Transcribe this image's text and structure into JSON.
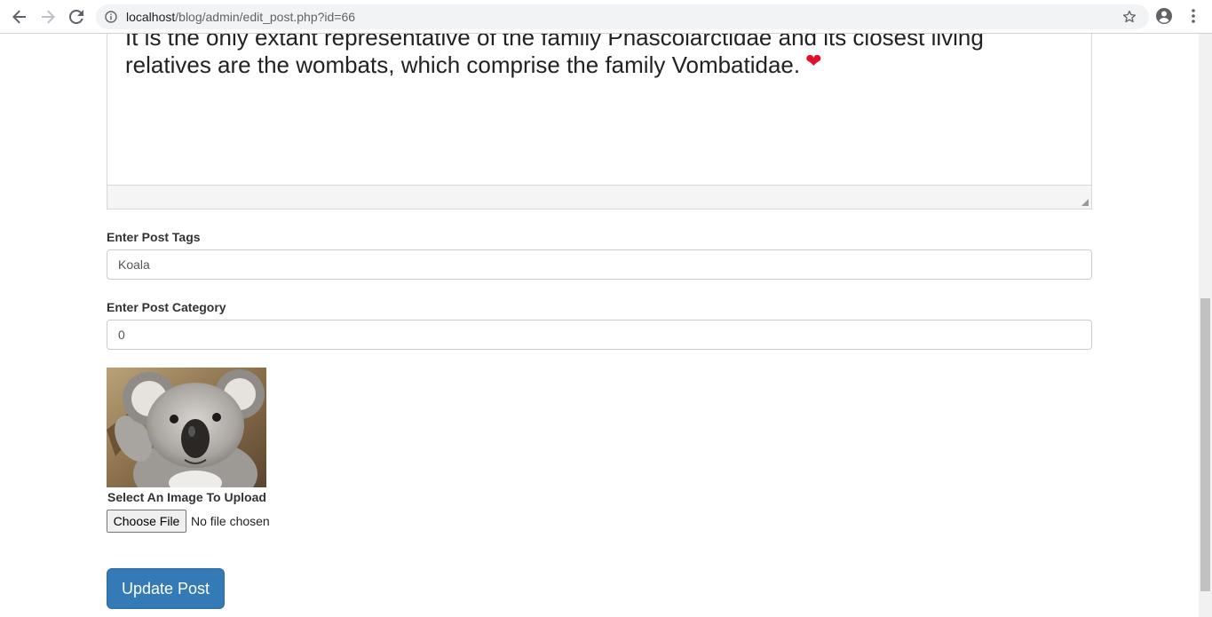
{
  "browser": {
    "url_host": "localhost",
    "url_path": "/blog/admin/edit_post.php?id=66"
  },
  "editor": {
    "line1": "It is the only extant representative of the family Phascolarctidae and its closest living",
    "line2": "relatives are the wombats, which comprise the family Vombatidae.",
    "emoji": "❤"
  },
  "form": {
    "tags_label": "Enter Post Tags",
    "tags_value": "Koala",
    "category_label": "Enter Post Category",
    "category_value": "0",
    "upload_label": "Select An Image To Upload",
    "choose_file_label": "Choose File",
    "file_status": "No file chosen",
    "submit_label": "Update Post"
  },
  "colors": {
    "primary_button": "#337ab7",
    "heart": "#e0102a"
  },
  "icons": [
    "back-icon",
    "forward-icon",
    "reload-icon",
    "info-icon",
    "star-icon",
    "profile-icon",
    "menu-icon",
    "heart-icon"
  ]
}
